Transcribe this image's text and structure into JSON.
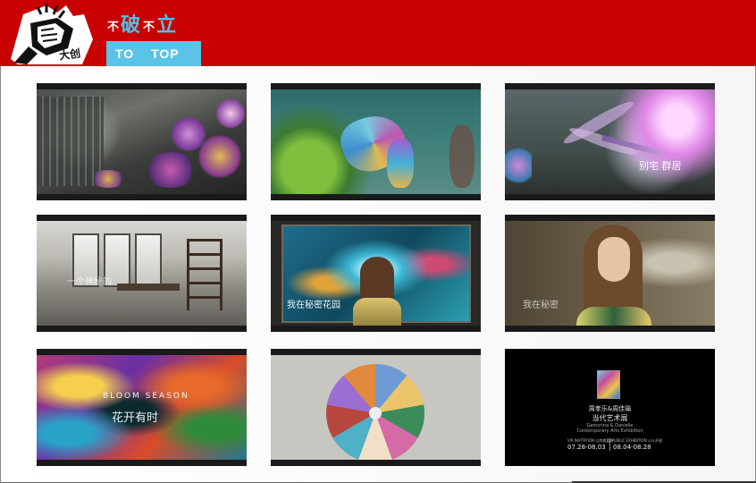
{
  "header": {
    "logo_text": "大创",
    "slogan": {
      "bu1": "不",
      "po": "破",
      "bu2": "不",
      "li": "立"
    },
    "top_button": "TO TOP",
    "colors": {
      "bar": "#c90000",
      "accent": "#5bc4e6"
    }
  },
  "gallery": {
    "tiles": [
      {
        "id": "crystal-flower",
        "caption": ""
      },
      {
        "id": "glass-fish",
        "caption": ""
      },
      {
        "id": "dragonfly",
        "caption": "别宅 群居"
      },
      {
        "id": "interior",
        "caption": "一个神秘的"
      },
      {
        "id": "painting-viewer",
        "caption": "我在秘密花园"
      },
      {
        "id": "portrait",
        "caption": "我在秘密"
      },
      {
        "id": "abstract",
        "caption_en": "BLOOM SEASON",
        "caption": "花开有时"
      },
      {
        "id": "collage",
        "caption": ""
      },
      {
        "id": "poster",
        "title_line1": "周孝乐&周佳瑜",
        "title_line2": "当代艺术展",
        "subtitle_line1": "Gemorina & Danielle",
        "subtitle_line2": "Contemporary Arts Exhibition",
        "vip_label": "VIP INVITATION 以特邀嘉宾",
        "public_label": "PUBLIC EXHIBITION 公众开放",
        "vip_dates": "07.28-08.03",
        "public_dates": "08.04-08.28"
      }
    ]
  }
}
